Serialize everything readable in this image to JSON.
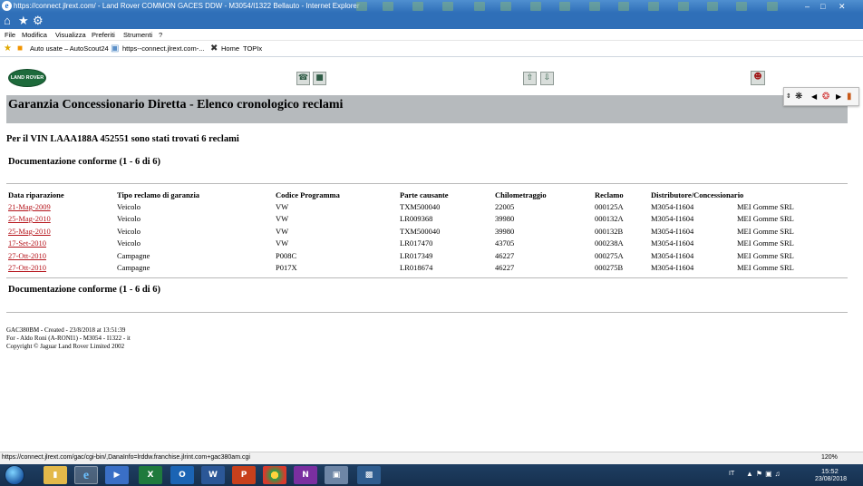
{
  "window": {
    "title": "https://connect.jlrext.com/ - Land Rover COMMON GACES DDW - M3054/I1322 Bellauto - Internet Explorer"
  },
  "menu": [
    "File",
    "Modifica",
    "Visualizza",
    "Preferiti",
    "Strumenti",
    "?"
  ],
  "favorites": [
    "Auto usate – AutoScout24",
    "https--connect.jlrext.com-...",
    "Home",
    "TOPIx"
  ],
  "logo_text": "LAND ROVER",
  "page": {
    "title": "Garanzia Concessionario Diretta - Elenco cronologico reclami",
    "vin_line": "Per il VIN LAAA188A 452551 sono stati trovati 6 reclami",
    "doc_header": "Documentazione conforme (1 - 6 di 6)",
    "doc_footer": "Documentazione conforme (1 - 6 di 6)"
  },
  "table": {
    "headers": [
      "Data riparazione",
      "Tipo reclamo di garanzia",
      "Codice Programma",
      "Parte causante",
      "Chilometraggio",
      "Reclamo",
      "Distributore/Concessionario"
    ],
    "rows": [
      {
        "date": "21-Mag-2009",
        "type": "Veicolo",
        "program": "VW",
        "part": "TXM500040",
        "km": "22005",
        "claim": "000125A",
        "distributor": "M3054-I1604",
        "dealer": "MEI Gomme SRL"
      },
      {
        "date": "25-Mag-2010",
        "type": "Veicolo",
        "program": "VW",
        "part": "LR009368",
        "km": "39980",
        "claim": "000132A",
        "distributor": "M3054-I1604",
        "dealer": "MEI Gomme SRL"
      },
      {
        "date": "25-Mag-2010",
        "type": "Veicolo",
        "program": "VW",
        "part": "TXM500040",
        "km": "39980",
        "claim": "000132B",
        "distributor": "M3054-I1604",
        "dealer": "MEI Gomme SRL"
      },
      {
        "date": "17-Set-2010",
        "type": "Veicolo",
        "program": "VW",
        "part": "LR017470",
        "km": "43705",
        "claim": "000238A",
        "distributor": "M3054-I1604",
        "dealer": "MEI Gomme SRL"
      },
      {
        "date": "27-Ott-2010",
        "type": "Campagne",
        "program": "P008C",
        "part": "LR017349",
        "km": "46227",
        "claim": "000275A",
        "distributor": "M3054-I1604",
        "dealer": "MEI Gomme SRL"
      },
      {
        "date": "27-Ott-2010",
        "type": "Campagne",
        "program": "P017X",
        "part": "LR018674",
        "km": "46227",
        "claim": "000275B",
        "distributor": "M3054-I1604",
        "dealer": "MEI Gomme SRL"
      }
    ]
  },
  "footer": {
    "line1": "GAC380BM - Created - 23/8/2018 at 13:51:39",
    "line2": "For - Aldo Roni (A-RONI1) - M3054 - I1322 - it",
    "line3": "Copyright © Jaguar Land Rover Limited 2002"
  },
  "status": {
    "url": "https://connect.jlrext.com/gac/cgi-bin/,DanaInfo=lrddw.franchise.jlrint.com+gac380am.cgi",
    "zoom": "120%"
  },
  "taskbar": {
    "lang": "IT",
    "time": "15:52",
    "date": "23/08/2018"
  },
  "colors": {
    "link": "#b5131a",
    "banner": "#b6babd",
    "ie_blue": "#2f6fb8"
  }
}
